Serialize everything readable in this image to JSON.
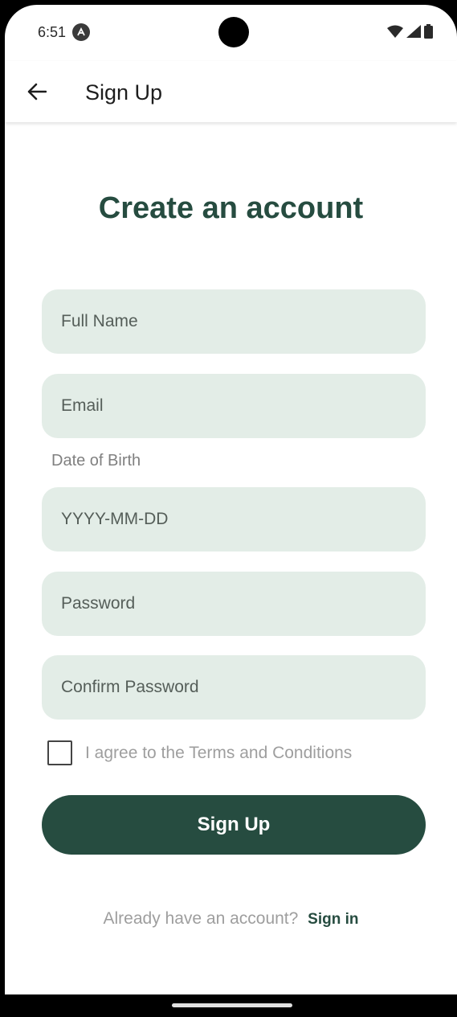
{
  "status_bar": {
    "time": "6:51",
    "notification_icon": "android-app-icon",
    "icons": [
      "wifi-icon",
      "signal-icon",
      "battery-icon"
    ]
  },
  "app_bar": {
    "back_icon": "arrow-left-icon",
    "title": "Sign Up"
  },
  "form": {
    "headline": "Create an account",
    "full_name_placeholder": "Full Name",
    "email_placeholder": "Email",
    "dob_label": "Date of Birth",
    "dob_placeholder": "YYYY-MM-DD",
    "password_placeholder": "Password",
    "confirm_password_placeholder": "Confirm Password",
    "terms_label": "I agree to the Terms and Conditions",
    "terms_checked": false,
    "submit_label": "Sign Up"
  },
  "footer": {
    "prompt": "Already have an account?",
    "link_label": "Sign in"
  },
  "colors": {
    "primary": "#264c40",
    "field_bg": "#e3ede7",
    "muted_text": "#9e9e9e"
  }
}
